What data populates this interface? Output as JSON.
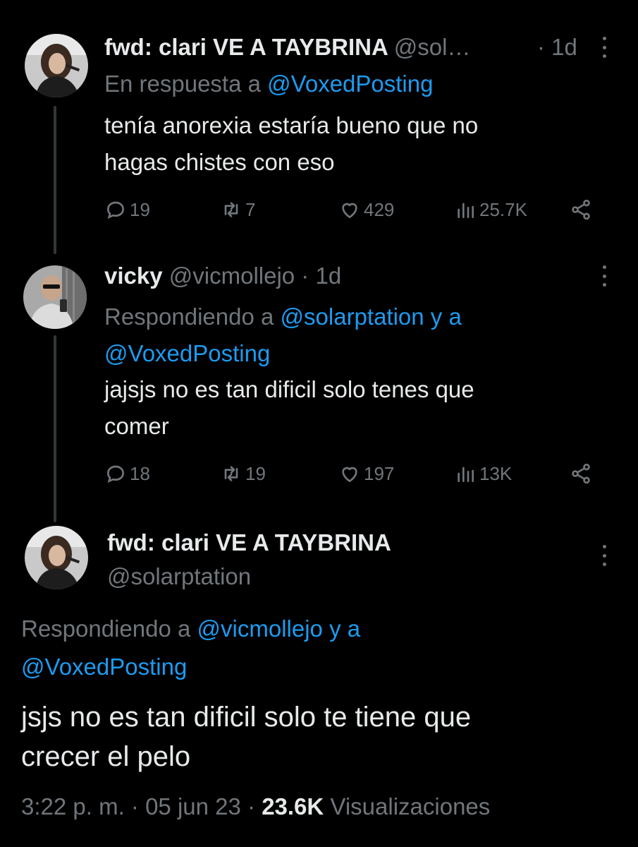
{
  "tweets": [
    {
      "display_name": "fwd: clari VE A TAYBRINA",
      "handle_trunc": "@sol…",
      "time": "· 1d",
      "reply_prefix": "En respuesta a ",
      "reply_to": "@VoxedPosting",
      "text_line1": "tenía anorexia estaría bueno que no",
      "text_line2": "hagas chistes con eso",
      "replies": "19",
      "retweets": "7",
      "likes": "429",
      "views": "25.7K"
    },
    {
      "display_name": "vicky",
      "handle_time": "@vicmollejo · 1d",
      "reply_prefix": "Respondiendo a ",
      "reply_to_1": "@solarptation y a",
      "reply_to_2": "@VoxedPosting",
      "text_line1": "jajsjs no es tan dificil solo tenes que",
      "text_line2": "comer",
      "replies": "18",
      "retweets": "19",
      "likes": "197",
      "views": "13K"
    }
  ],
  "focused": {
    "display_name": "fwd: clari VE A TAYBRINA",
    "handle": "@solarptation",
    "reply_prefix": "Respondiendo a ",
    "reply_to_1": "@vicmollejo y a",
    "reply_to_2": "@VoxedPosting",
    "text_line1": "jsjs no es tan dificil solo te tiene que",
    "text_line2": "crecer el pelo",
    "timestamp": "3:22 p. m. · 05 jun 23 · ",
    "views_count": "23.6K",
    "views_label": " Visualizaciones"
  },
  "colors": {
    "background": "#000000",
    "text": "#e7e9ea",
    "secondary": "#71767b",
    "link": "#1d9bf0"
  },
  "icons": [
    "reply-icon",
    "retweet-icon",
    "like-icon",
    "views-icon",
    "share-icon",
    "more-icon"
  ]
}
